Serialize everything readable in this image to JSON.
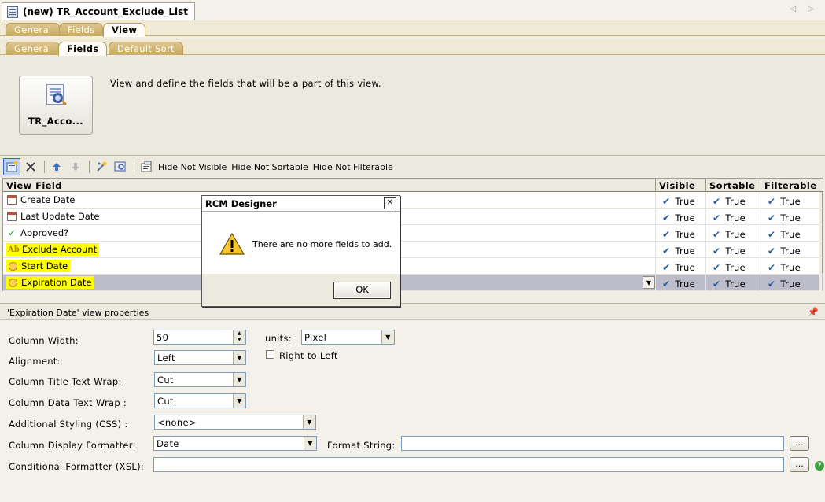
{
  "document_tab": {
    "title": "(new) TR_Account_Exclude_List"
  },
  "nav": {
    "arrows": "◁ ▷"
  },
  "tabs_level1": [
    {
      "label": "General"
    },
    {
      "label": "Fields"
    },
    {
      "label": "View"
    }
  ],
  "tabs_level2": [
    {
      "label": "General"
    },
    {
      "label": "Fields"
    },
    {
      "label": "Default Sort"
    }
  ],
  "view_button": {
    "label": "TR_Acco..."
  },
  "view_description": "View and define the fields that will be a part of this view.",
  "toolbar": {
    "hide_not_visible": "Hide Not Visible",
    "hide_not_sortable": "Hide Not Sortable",
    "hide_not_filterable": "Hide Not Filterable"
  },
  "grid": {
    "columns": [
      "View Field",
      "Visible",
      "Sortable",
      "Filterable"
    ],
    "rows": [
      {
        "field": "Create Date",
        "icon": "calendar-icon",
        "visible": "True",
        "sortable": "True",
        "filterable": "True"
      },
      {
        "field": "Last Update Date",
        "icon": "calendar-icon",
        "visible": "True",
        "sortable": "True",
        "filterable": "True"
      },
      {
        "field": "Approved?",
        "icon": "check-icon",
        "visible": "True",
        "sortable": "True",
        "filterable": "True"
      },
      {
        "field": "Exclude Account",
        "icon": "text-field-icon",
        "visible": "True",
        "sortable": "True",
        "filterable": "True"
      },
      {
        "field": "Start Date",
        "icon": "clock-icon",
        "visible": "True",
        "sortable": "True",
        "filterable": "True"
      },
      {
        "field": "Expiration Date",
        "icon": "clock-icon",
        "visible": "True",
        "sortable": "True",
        "filterable": "True"
      }
    ]
  },
  "properties": {
    "header": "'Expiration Date' view properties",
    "column_width_label": "Column Width:",
    "column_width_value": "50",
    "units_label": "units:",
    "units_value": "Pixel",
    "alignment_label": "Alignment:",
    "alignment_value": "Left",
    "right_to_left_label": "Right to Left",
    "title_wrap_label": "Column Title Text Wrap:",
    "title_wrap_value": "Cut",
    "data_wrap_label": "Column Data Text Wrap :",
    "data_wrap_value": "Cut",
    "css_label": "Additional Styling (CSS) :",
    "css_value": "<none>",
    "formatter_label": "Column Display Formatter:",
    "formatter_value": "Date",
    "format_string_label": "Format String:",
    "format_string_value": "",
    "conditional_label": "Conditional Formatter (XSL):",
    "conditional_value": "",
    "ellipsis": "...",
    "help": "?"
  },
  "dialog": {
    "title": "RCM Designer",
    "close": "✕",
    "message": "There are no more fields to add.",
    "ok_label": "OK"
  },
  "colors": {
    "highlight": "#ffff00",
    "selected_row": "#bdbccb",
    "tab_gold": "#c8a95e"
  }
}
